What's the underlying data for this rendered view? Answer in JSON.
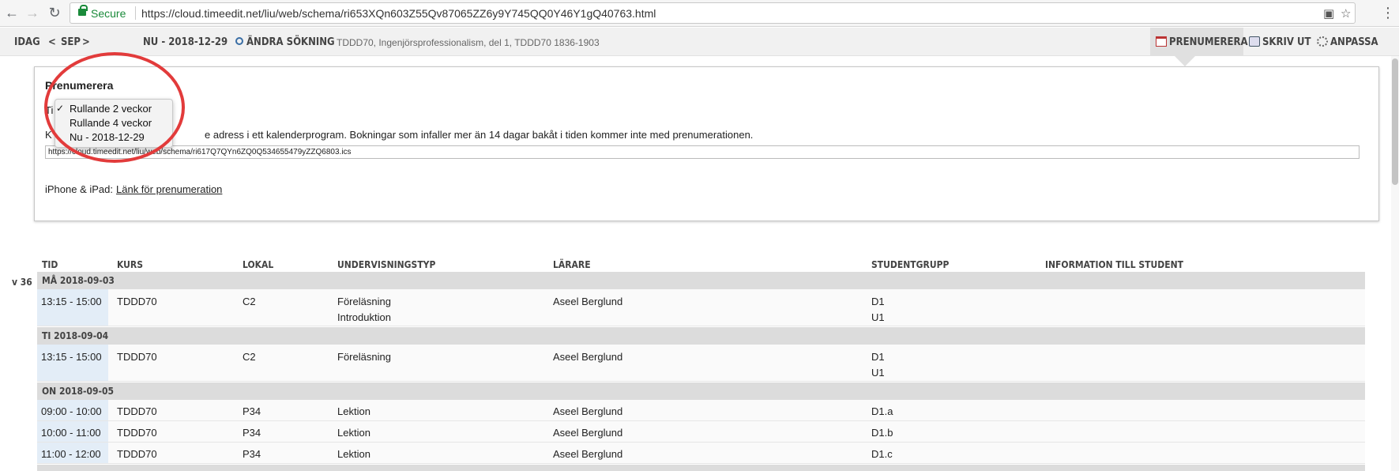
{
  "browser": {
    "back": "←",
    "forward": "→",
    "reload": "↻",
    "secure_label": "Secure",
    "url": "https://cloud.timeedit.net/liu/web/schema/ri653XQn603Z55Qv87065ZZ6y9Y745QQ0Y46Y1gQ40763.html",
    "translate_icon": "▣",
    "star_icon": "☆",
    "menu_icon": "⋮"
  },
  "header": {
    "today": "IDAG",
    "prev": "<",
    "month": "SEP",
    "next": ">",
    "range": "NU - 2018-12-29",
    "change_search": "ÄNDRA SÖKNING",
    "search_desc": "TDDD70, Ingenjörsprofessionalism, del 1, TDDD70 1836-1903",
    "subscribe": "PRENUMERERA",
    "print": "SKRIV UT",
    "customize": "ANPASSA"
  },
  "panel": {
    "title": "Prenumerera",
    "time_prefix": "Ti",
    "instr_prefix": "K",
    "instruction": "e adress i ett kalenderprogram. Bokningar som infaller mer än 14 dagar bakåt i tiden kommer inte med prenumerationen.",
    "ics_url": "https://cloud.timeedit.net/liu/web/schema/ri617Q7QYn6ZQ0Q534655479yZZQ6803.ics",
    "iphone_label": "iPhone & iPad:",
    "iphone_link": "Länk för prenumeration"
  },
  "dropdown": {
    "check": "✓",
    "options": [
      "Rullande 2 veckor",
      "Rullande 4 veckor",
      "Nu - 2018-12-29"
    ],
    "selected": "Rullande 2 veckor"
  },
  "table": {
    "columns": [
      "TID",
      "KURS",
      "LOKAL",
      "UNDERVISNINGSTYP",
      "LÄRARE",
      "STUDENTGRUPP",
      "INFORMATION TILL STUDENT"
    ],
    "week": "v 36",
    "days": [
      {
        "label": "MÅ 2018-09-03",
        "rows": [
          {
            "time": "13:15 - 15:00",
            "course": "TDDD70",
            "room": "C2",
            "type1": "Föreläsning",
            "type2": "Introduktion",
            "teacher": "Aseel Berglund",
            "group1": "D1",
            "group2": "U1"
          }
        ]
      },
      {
        "label": "TI 2018-09-04",
        "rows": [
          {
            "time": "13:15 - 15:00",
            "course": "TDDD70",
            "room": "C2",
            "type1": "Föreläsning",
            "type2": "",
            "teacher": "Aseel Berglund",
            "group1": "D1",
            "group2": "U1"
          }
        ]
      },
      {
        "label": "ON 2018-09-05",
        "rows": [
          {
            "time": "09:00 - 10:00",
            "course": "TDDD70",
            "room": "P34",
            "type1": "Lektion",
            "type2": "",
            "teacher": "Aseel Berglund",
            "group1": "D1.a",
            "group2": ""
          },
          {
            "time": "10:00 - 11:00",
            "course": "TDDD70",
            "room": "P34",
            "type1": "Lektion",
            "type2": "",
            "teacher": "Aseel Berglund",
            "group1": "D1.b",
            "group2": ""
          },
          {
            "time": "11:00 - 12:00",
            "course": "TDDD70",
            "room": "P34",
            "type1": "Lektion",
            "type2": "",
            "teacher": "Aseel Berglund",
            "group1": "D1.c",
            "group2": ""
          }
        ]
      }
    ]
  }
}
